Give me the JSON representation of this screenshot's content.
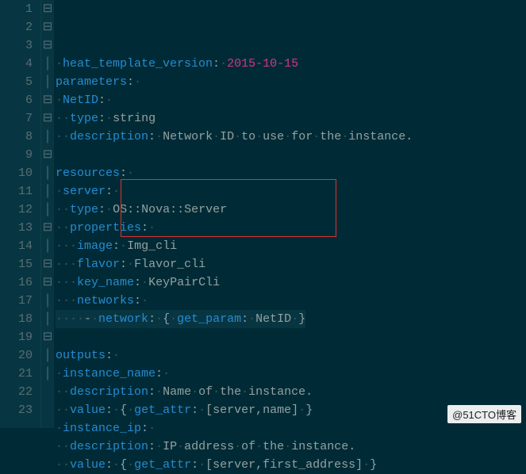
{
  "watermark": "@51CTO博客",
  "lines": [
    {
      "n": 1,
      "fold": "-",
      "seg": [
        [
          "ws",
          "·"
        ],
        [
          "key",
          "heat_template_version"
        ],
        [
          "val",
          ":"
        ],
        [
          "ws",
          "·"
        ],
        [
          "num",
          "2015-10-15"
        ]
      ]
    },
    {
      "n": 2,
      "fold": "-",
      "seg": [
        [
          "key",
          "parameters"
        ],
        [
          "val",
          ":"
        ],
        [
          "ws",
          "·"
        ]
      ]
    },
    {
      "n": 3,
      "fold": "-",
      "seg": [
        [
          "ws",
          "·"
        ],
        [
          "key",
          "NetID"
        ],
        [
          "val",
          ":"
        ],
        [
          "ws",
          "·"
        ]
      ]
    },
    {
      "n": 4,
      "fold": "|",
      "seg": [
        [
          "ws",
          "··"
        ],
        [
          "key",
          "type"
        ],
        [
          "val",
          ":"
        ],
        [
          "ws",
          "·"
        ],
        [
          "val",
          "string"
        ]
      ]
    },
    {
      "n": 5,
      "fold": "|",
      "seg": [
        [
          "ws",
          "··"
        ],
        [
          "key",
          "description"
        ],
        [
          "val",
          ":"
        ],
        [
          "ws",
          "·"
        ],
        [
          "val",
          "Network"
        ],
        [
          "ws",
          "·"
        ],
        [
          "val",
          "ID"
        ],
        [
          "ws",
          "·"
        ],
        [
          "val",
          "to"
        ],
        [
          "ws",
          "·"
        ],
        [
          "val",
          "use"
        ],
        [
          "ws",
          "·"
        ],
        [
          "val",
          "for"
        ],
        [
          "ws",
          "·"
        ],
        [
          "val",
          "the"
        ],
        [
          "ws",
          "·"
        ],
        [
          "val",
          "instance."
        ]
      ]
    },
    {
      "n": 6,
      "fold": " ",
      "seg": [
        [
          "val",
          ""
        ]
      ]
    },
    {
      "n": 7,
      "fold": "-",
      "seg": [
        [
          "key",
          "resources"
        ],
        [
          "val",
          ":"
        ],
        [
          "ws",
          "·"
        ]
      ]
    },
    {
      "n": 8,
      "fold": "-",
      "seg": [
        [
          "ws",
          "·"
        ],
        [
          "key",
          "server"
        ],
        [
          "val",
          ":"
        ],
        [
          "ws",
          "·"
        ]
      ]
    },
    {
      "n": 9,
      "fold": "|",
      "seg": [
        [
          "ws",
          "··"
        ],
        [
          "key",
          "type"
        ],
        [
          "val",
          ":"
        ],
        [
          "ws",
          "·"
        ],
        [
          "val",
          "OS::Nova::Server"
        ]
      ]
    },
    {
      "n": 10,
      "fold": "-",
      "seg": [
        [
          "ws",
          "··"
        ],
        [
          "key",
          "properties"
        ],
        [
          "val",
          ":"
        ],
        [
          "ws",
          "·"
        ]
      ]
    },
    {
      "n": 11,
      "fold": "|",
      "seg": [
        [
          "ws",
          "···"
        ],
        [
          "key",
          "image"
        ],
        [
          "val",
          ":"
        ],
        [
          "ws",
          "·"
        ],
        [
          "val",
          "Img_cli"
        ]
      ]
    },
    {
      "n": 12,
      "fold": "|",
      "seg": [
        [
          "ws",
          "···"
        ],
        [
          "key",
          "flavor"
        ],
        [
          "val",
          ":"
        ],
        [
          "ws",
          "·"
        ],
        [
          "val",
          "Flavor_cli"
        ]
      ]
    },
    {
      "n": 13,
      "fold": "|",
      "seg": [
        [
          "ws",
          "···"
        ],
        [
          "key",
          "key_name"
        ],
        [
          "val",
          ":"
        ],
        [
          "ws",
          "·"
        ],
        [
          "val",
          "KeyPairCli"
        ]
      ]
    },
    {
      "n": 14,
      "fold": "-",
      "seg": [
        [
          "ws",
          "···"
        ],
        [
          "key",
          "networks"
        ],
        [
          "val",
          ":"
        ],
        [
          "ws",
          "·"
        ]
      ]
    },
    {
      "n": 15,
      "fold": "|",
      "hl": true,
      "seg": [
        [
          "ws",
          "····"
        ],
        [
          "val",
          "-"
        ],
        [
          "ws",
          "·"
        ],
        [
          "key",
          "network"
        ],
        [
          "val",
          ":"
        ],
        [
          "ws",
          "·"
        ],
        [
          "val",
          "{"
        ],
        [
          "ws",
          "·"
        ],
        [
          "key",
          "get_param"
        ],
        [
          "val",
          ":"
        ],
        [
          "ws",
          "·"
        ],
        [
          "val",
          "NetID"
        ],
        [
          "ws",
          "·"
        ],
        [
          "val",
          "}"
        ]
      ]
    },
    {
      "n": 16,
      "fold": " ",
      "seg": [
        [
          "val",
          ""
        ]
      ]
    },
    {
      "n": 17,
      "fold": "-",
      "seg": [
        [
          "key",
          "outputs"
        ],
        [
          "val",
          ":"
        ],
        [
          "ws",
          "·"
        ]
      ]
    },
    {
      "n": 18,
      "fold": "-",
      "seg": [
        [
          "ws",
          "·"
        ],
        [
          "key",
          "instance_name"
        ],
        [
          "val",
          ":"
        ],
        [
          "ws",
          "·"
        ]
      ]
    },
    {
      "n": 19,
      "fold": "|",
      "seg": [
        [
          "ws",
          "··"
        ],
        [
          "key",
          "description"
        ],
        [
          "val",
          ":"
        ],
        [
          "ws",
          "·"
        ],
        [
          "val",
          "Name"
        ],
        [
          "ws",
          "·"
        ],
        [
          "val",
          "of"
        ],
        [
          "ws",
          "·"
        ],
        [
          "val",
          "the"
        ],
        [
          "ws",
          "·"
        ],
        [
          "val",
          "instance."
        ]
      ]
    },
    {
      "n": 20,
      "fold": "|",
      "seg": [
        [
          "ws",
          "··"
        ],
        [
          "key",
          "value"
        ],
        [
          "val",
          ":"
        ],
        [
          "ws",
          "·"
        ],
        [
          "val",
          "{"
        ],
        [
          "ws",
          "·"
        ],
        [
          "key",
          "get_attr"
        ],
        [
          "val",
          ":"
        ],
        [
          "ws",
          "·"
        ],
        [
          "val",
          "[server,name]"
        ],
        [
          "ws",
          "·"
        ],
        [
          "val",
          "}"
        ]
      ]
    },
    {
      "n": 21,
      "fold": "-",
      "seg": [
        [
          "ws",
          "·"
        ],
        [
          "key",
          "instance_ip"
        ],
        [
          "val",
          ":"
        ],
        [
          "ws",
          "·"
        ]
      ]
    },
    {
      "n": 22,
      "fold": "|",
      "seg": [
        [
          "ws",
          "··"
        ],
        [
          "key",
          "description"
        ],
        [
          "val",
          ":"
        ],
        [
          "ws",
          "·"
        ],
        [
          "val",
          "IP"
        ],
        [
          "ws",
          "·"
        ],
        [
          "val",
          "address"
        ],
        [
          "ws",
          "·"
        ],
        [
          "val",
          "of"
        ],
        [
          "ws",
          "·"
        ],
        [
          "val",
          "the"
        ],
        [
          "ws",
          "·"
        ],
        [
          "val",
          "instance."
        ]
      ]
    },
    {
      "n": 23,
      "fold": "|",
      "seg": [
        [
          "ws",
          "··"
        ],
        [
          "key",
          "value"
        ],
        [
          "val",
          ":"
        ],
        [
          "ws",
          "·"
        ],
        [
          "val",
          "{"
        ],
        [
          "ws",
          "·"
        ],
        [
          "key",
          "get_attr"
        ],
        [
          "val",
          ":"
        ],
        [
          "ws",
          "·"
        ],
        [
          "val",
          "[server,first_address]"
        ],
        [
          "ws",
          "·"
        ],
        [
          "val",
          "}"
        ]
      ]
    }
  ]
}
